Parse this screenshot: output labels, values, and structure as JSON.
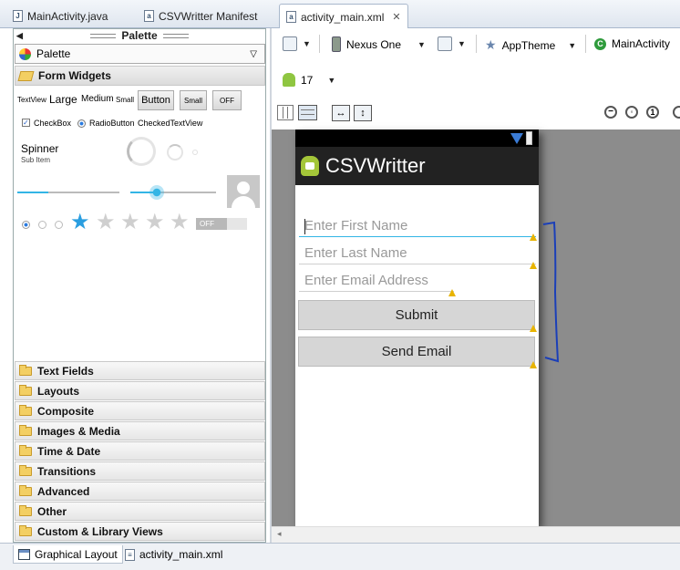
{
  "tabs": [
    {
      "label": "MainActivity.java"
    },
    {
      "label": "CSVWritter Manifest"
    },
    {
      "label": "activity_main.xml"
    }
  ],
  "palette": {
    "title": "Palette",
    "selector": "Palette",
    "form_widgets": "Form Widgets",
    "widgets": {
      "textview": "TextView",
      "large": "Large",
      "medium": "Medium",
      "small": "Small",
      "button": "Button",
      "small_button": "Small",
      "toggle": "OFF",
      "checkbox": "CheckBox",
      "radiobutton": "RadioButton",
      "checkedtextview": "CheckedTextView",
      "spinner": "Spinner",
      "subitem": "Sub Item",
      "switch": "OFF"
    },
    "categories": [
      "Text Fields",
      "Layouts",
      "Composite",
      "Images & Media",
      "Time & Date",
      "Transitions",
      "Advanced",
      "Other",
      "Custom & Library Views"
    ]
  },
  "toolbar": {
    "device": "Nexus One",
    "theme": "AppTheme",
    "activity": "MainActivity",
    "api": "17"
  },
  "app": {
    "title": "CSVWritter",
    "fields": [
      {
        "placeholder": "Enter First Name"
      },
      {
        "placeholder": "Enter Last Name"
      },
      {
        "placeholder": "Enter Email Address"
      }
    ],
    "buttons": [
      {
        "label": "Submit"
      },
      {
        "label": "Send Email"
      }
    ]
  },
  "bottom_tabs": [
    {
      "label": "Graphical Layout"
    },
    {
      "label": "activity_main.xml"
    }
  ],
  "colors": {
    "accent": "#33b5e5",
    "annotation": "#1b3fb8"
  }
}
